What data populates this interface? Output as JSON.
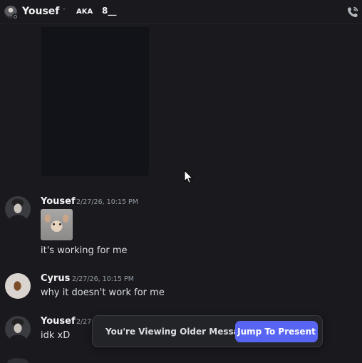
{
  "header": {
    "title": "Yousef",
    "separator": "•",
    "aka_label": "AKA",
    "aka_value": "8__",
    "call_icon": "phone-call-icon"
  },
  "messages": [
    {
      "username": "Yousef",
      "timestamp": "2/27/26, 10:15 PM",
      "avatar": "yousef-avatar",
      "attachment": "dog-meme-image",
      "text": "it's working for me"
    },
    {
      "username": "Cyrus",
      "timestamp": "2/27/26, 10:15 PM",
      "avatar": "cyrus-avatar",
      "text": "why it doesn't work for me"
    },
    {
      "username": "Yousef",
      "timestamp": "2/27",
      "avatar": "yousef-avatar",
      "text": "idk xD"
    }
  ],
  "older_messages_bar": {
    "label": "You're Viewing Older Messages",
    "button_label": "Jump To Present"
  },
  "colors": {
    "background": "#1a1a1e",
    "accent": "#5865f2",
    "username": "#f2f3f5",
    "timestamp": "#949ba4",
    "text": "#dbdee1"
  }
}
